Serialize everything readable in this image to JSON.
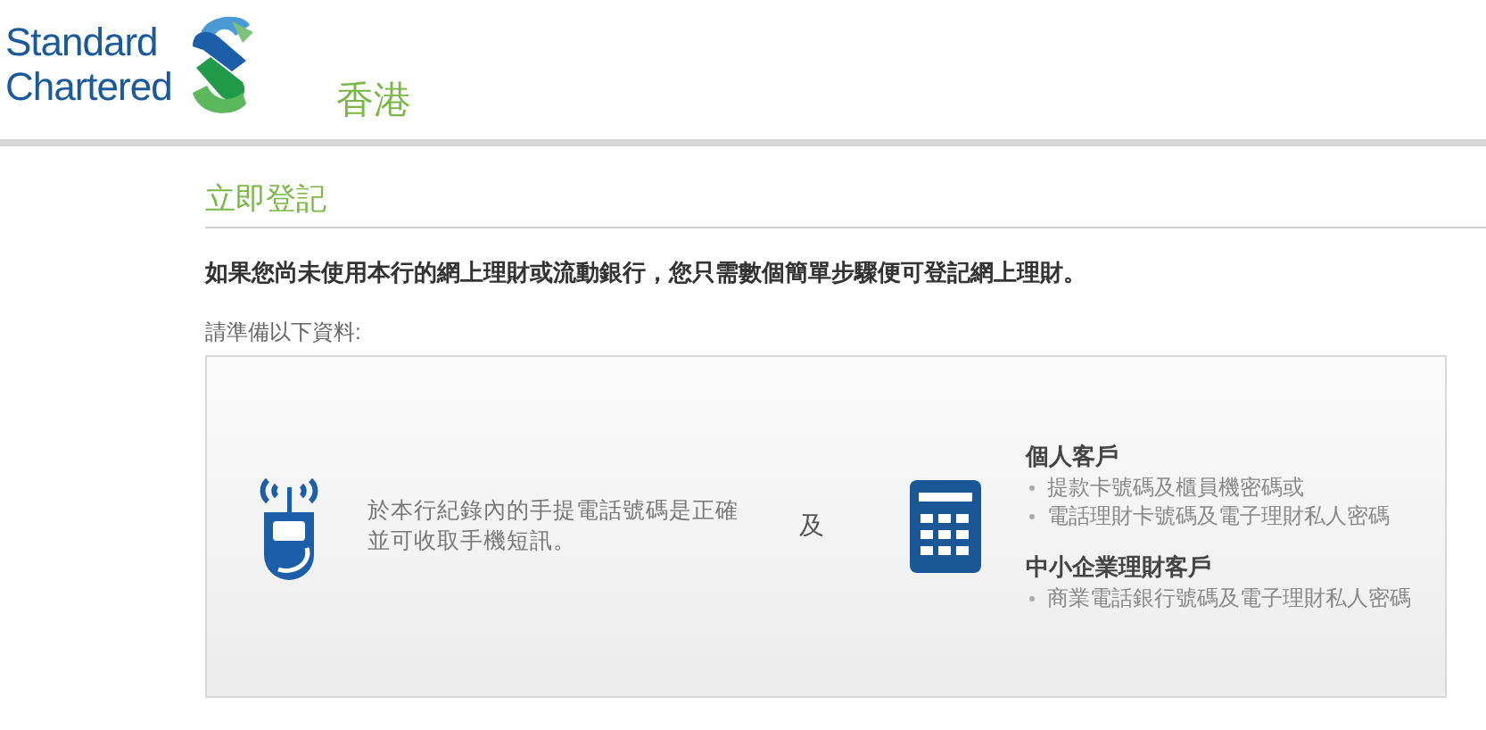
{
  "header": {
    "logo_lines": [
      "Standard",
      "Chartered"
    ],
    "region": "香港"
  },
  "heading": "立即登記",
  "intro": "如果您尚未使用本行的網上理財或流動銀行，您只需數個簡單步驟便可登記網上理財。",
  "prepare_label": "請準備以下資料:",
  "requirements": {
    "mobile_text": [
      "於本行紀錄內的手提電話號碼是正確",
      "並可收取手機短訊。"
    ],
    "conjunction": "及",
    "groups": [
      {
        "title": "個人客戶",
        "items": [
          "提款卡號碼及櫃員機密碼或",
          "電話理財卡號碼及電子理財私人密碼"
        ]
      },
      {
        "title": "中小企業理財客戶",
        "items": [
          "商業電話銀行號碼及電子理財私人密碼"
        ]
      }
    ]
  }
}
